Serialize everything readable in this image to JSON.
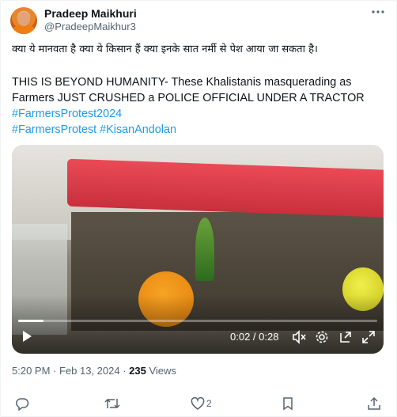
{
  "author": {
    "name": "Pradeep Maikhuri",
    "handle": "@PradeepMaikhur3"
  },
  "tweet": {
    "hindi_text": "क्या ये मानवता है क्या ये किसान हैं क्या इनके सात नर्मी से पेश आया जा सकता है।",
    "english_line1": "THIS IS BEYOND HUMANITY- These Khalistanis masquerading as",
    "english_line2": "Farmers JUST CRUSHED a POLICE OFFICIAL UNDER A TRACTOR",
    "hashtag_line1": "#FarmersProtest2024",
    "hashtag_line2": "#FarmersProtest #KisanAndolan"
  },
  "video": {
    "time": "0:02 / 0:28",
    "progress": 0.07
  },
  "meta": {
    "time": "5:20 PM · Feb 13, 2024 · ",
    "views_count": "235",
    "views_label": " Views"
  },
  "actions": {
    "like_count": "2"
  },
  "icons": [
    "more-icon",
    "play-icon",
    "mute-icon",
    "settings-icon",
    "pip-icon",
    "fullscreen-icon",
    "reply-icon",
    "retweet-icon",
    "like-icon",
    "bookmark-icon",
    "share-icon"
  ]
}
